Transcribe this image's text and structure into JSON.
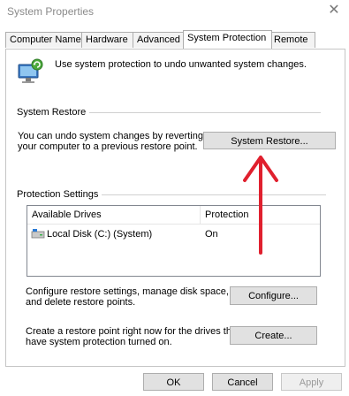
{
  "window": {
    "title": "System Properties",
    "close_glyph": "✕"
  },
  "tabs": [
    {
      "label": "Computer Name",
      "active": false
    },
    {
      "label": "Hardware",
      "active": false
    },
    {
      "label": "Advanced",
      "active": false
    },
    {
      "label": "System Protection",
      "active": true
    },
    {
      "label": "Remote",
      "active": false
    }
  ],
  "intro": {
    "icon": "computer-restore-icon",
    "text": "Use system protection to undo unwanted system changes."
  },
  "system_restore": {
    "heading": "System Restore",
    "description_line1": "You can undo system changes by reverting",
    "description_line2": "your computer to a previous restore point.",
    "button_label": "System Restore..."
  },
  "protection_settings": {
    "heading": "Protection Settings",
    "columns": [
      "Available Drives",
      "Protection"
    ],
    "rows": [
      {
        "icon": "drive-icon",
        "drive": "Local Disk (C:) (System)",
        "protection": "On"
      }
    ]
  },
  "configure": {
    "line1": "Configure restore settings, manage disk space,",
    "line2": "and delete restore points.",
    "button_label": "Configure..."
  },
  "create": {
    "line1": "Create a restore point right now for the drives that",
    "line2": "have system protection turned on.",
    "button_label": "Create..."
  },
  "footer": {
    "ok_label": "OK",
    "cancel_label": "Cancel",
    "apply_label": "Apply"
  },
  "colors": {
    "arrow": "#e0202e",
    "accent_drive": "#2b7bd6"
  }
}
